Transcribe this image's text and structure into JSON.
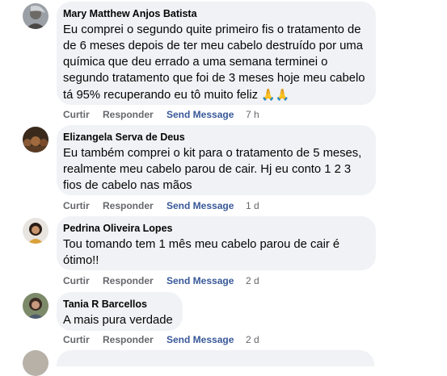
{
  "comments": [
    {
      "author": "Mary Matthew Anjos Batista",
      "text": "Eu comprei o segundo quite primeiro fis o tratamento de de 6 meses depois de ter meu cabelo destruído por uma química que deu errado a uma semana terminei o segundo tratamento que foi de 3 meses hoje meu cabelo tá 95% recuperando eu tô muito feliz",
      "emoji": "🙏🙏",
      "like": "Curtir",
      "reply": "Responder",
      "send": "Send Message",
      "time": "7 h"
    },
    {
      "author": "Elizangela Serva de Deus",
      "text": "Eu também comprei o kit para o tratamento de 5 meses, realmente meu cabelo parou de cair. Hj eu conto 1 2 3 fios de cabelo nas mãos",
      "like": "Curtir",
      "reply": "Responder",
      "send": "Send Message",
      "time": "1 d"
    },
    {
      "author": "Pedrina Oliveira Lopes",
      "text": "Tou tomando tem 1 mês meu cabelo parou de cair é ótimo!!",
      "like": "Curtir",
      "reply": "Responder",
      "send": "Send Message",
      "time": "2 d"
    },
    {
      "author": "Tania R Barcellos",
      "text": "A mais pura verdade",
      "like": "Curtir",
      "reply": "Responder",
      "send": "Send Message",
      "time": "2 d"
    }
  ],
  "colors": {
    "bubble": "#f0f2f5",
    "action_gray": "#65676b",
    "send_blue": "#385898"
  }
}
